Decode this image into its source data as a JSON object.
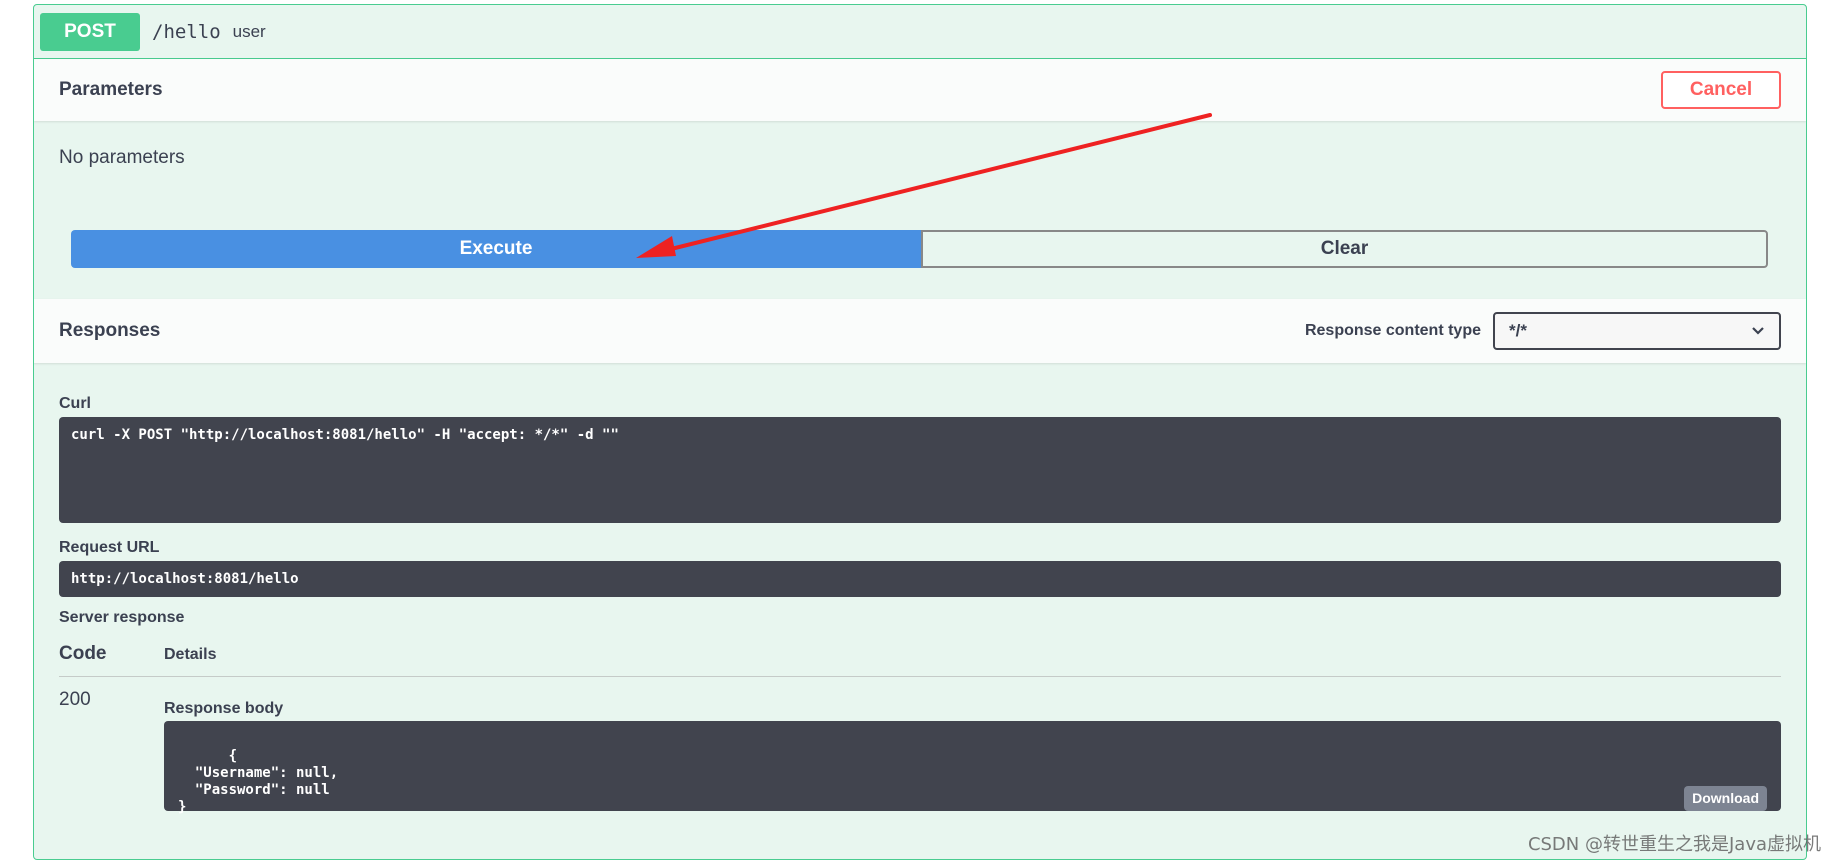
{
  "summary": {
    "method": "POST",
    "path": "/hello",
    "description": "user"
  },
  "parameters": {
    "title": "Parameters",
    "cancel_label": "Cancel",
    "empty_text": "No parameters",
    "execute_label": "Execute",
    "clear_label": "Clear"
  },
  "responses": {
    "title": "Responses",
    "content_type_label": "Response content type",
    "content_type_value": "*/*",
    "curl_label": "Curl",
    "curl_command": "curl -X POST \"http://localhost:8081/hello\" -H \"accept: */*\" -d \"\"",
    "request_url_label": "Request URL",
    "request_url": "http://localhost:8081/hello",
    "server_response_label": "Server response",
    "code_header": "Code",
    "details_header": "Details",
    "status_code": "200",
    "response_body_label": "Response body",
    "response_body": "{\n  \"Username\": null,\n  \"Password\": null\n}",
    "download_label": "Download"
  },
  "watermark": "CSDN @转世重生之我是Java虚拟机",
  "colors": {
    "post": "#49cc90",
    "execute": "#4990e2",
    "cancel": "#ff6060",
    "code_bg": "#41444e",
    "annotation_arrow": "#ee2222"
  },
  "icons": {
    "select_caret": "chevron-down-icon"
  }
}
